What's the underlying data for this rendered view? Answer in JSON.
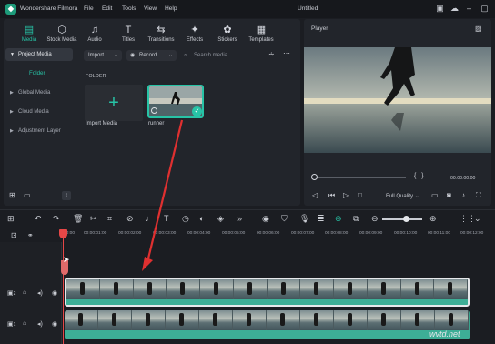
{
  "titlebar": {
    "app_name": "Wondershare Filmora",
    "menu": [
      "File",
      "Edit",
      "Tools",
      "View",
      "Help"
    ],
    "doc_title": "Untitled"
  },
  "media_tabs": [
    {
      "label": "Media",
      "icon": "media-icon"
    },
    {
      "label": "Stock Media",
      "icon": "stock-icon"
    },
    {
      "label": "Audio",
      "icon": "music-icon"
    },
    {
      "label": "Titles",
      "icon": "text-icon"
    },
    {
      "label": "Transitions",
      "icon": "transition-icon"
    },
    {
      "label": "Effects",
      "icon": "effects-icon"
    },
    {
      "label": "Stickers",
      "icon": "sticker-icon"
    },
    {
      "label": "Templates",
      "icon": "template-icon"
    }
  ],
  "sidebar": {
    "items": [
      "Project Media",
      "Global Media",
      "Cloud Media",
      "Adjustment Layer"
    ],
    "sub_item": "Folder"
  },
  "browser": {
    "import_label": "Import",
    "record_label": "Record",
    "search_placeholder": "Search media",
    "folder_heading": "FOLDER",
    "tiles": [
      {
        "label": "Import Media"
      },
      {
        "label": "runner"
      }
    ]
  },
  "player": {
    "title": "Player",
    "brackets": "{   }",
    "timecode": "00:00:00:00",
    "quality": "Full Quality"
  },
  "ruler": {
    "ticks": [
      "00:00",
      "00:00:01:00",
      "00:00:02:00",
      "00:00:03:00",
      "00:00:04:00",
      "00:00:05:00",
      "00:00:06:00",
      "00:00:07:00",
      "00:00:08:00",
      "00:00:09:00",
      "00:00:10:00",
      "00:00:11:00",
      "00:00:12:00"
    ]
  },
  "tracks": [
    {
      "number": "2"
    },
    {
      "number": "1"
    }
  ],
  "watermark": "wvtd.net",
  "colors": {
    "accent": "#27c3a6",
    "playhead": "#e64747",
    "arrow": "#e03030"
  }
}
